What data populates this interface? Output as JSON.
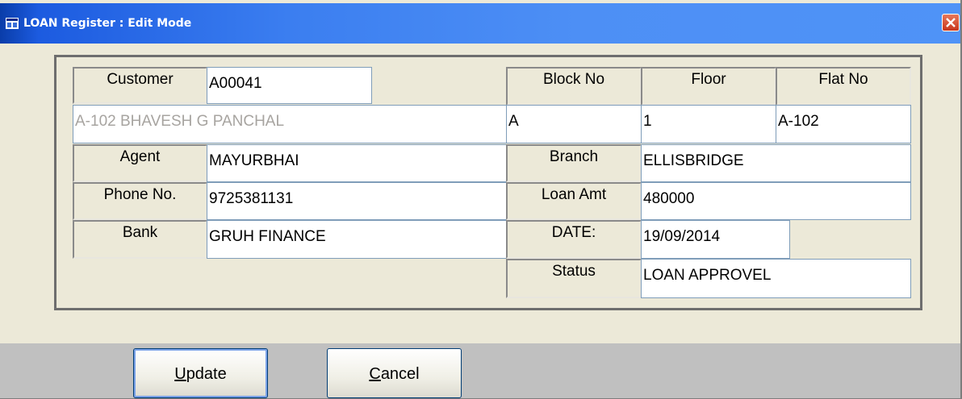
{
  "window": {
    "title": "LOAN Register : Edit Mode"
  },
  "form": {
    "customer": {
      "label": "Customer",
      "value": "A00041"
    },
    "customer_name": {
      "value": "A-102 BHAVESH G PANCHAL"
    },
    "block_no": {
      "label": "Block No",
      "value": "A"
    },
    "floor": {
      "label": "Floor",
      "value": "1"
    },
    "flat_no": {
      "label": "Flat No",
      "value": "A-102"
    },
    "agent": {
      "label": "Agent",
      "value": "MAYURBHAI"
    },
    "branch": {
      "label": "Branch",
      "value": "ELLISBRIDGE"
    },
    "phone": {
      "label": "Phone No.",
      "value": "9725381131"
    },
    "loan_amt": {
      "label": "Loan Amt",
      "value": "480000"
    },
    "bank": {
      "label": "Bank",
      "value": "GRUH FINANCE"
    },
    "date": {
      "label": "DATE:",
      "value": "19/09/2014"
    },
    "status": {
      "label": "Status",
      "value": "LOAN  APPROVEL"
    }
  },
  "buttons": {
    "update": {
      "accel": "U",
      "rest": "pdate"
    },
    "cancel": {
      "accel": "C",
      "rest": "ancel"
    }
  },
  "colors": {
    "titlebar": "#3b7ef0",
    "window_bg": "#ece9d8",
    "footer_bg": "#c0c0c0",
    "close_button": "#d9502f"
  }
}
